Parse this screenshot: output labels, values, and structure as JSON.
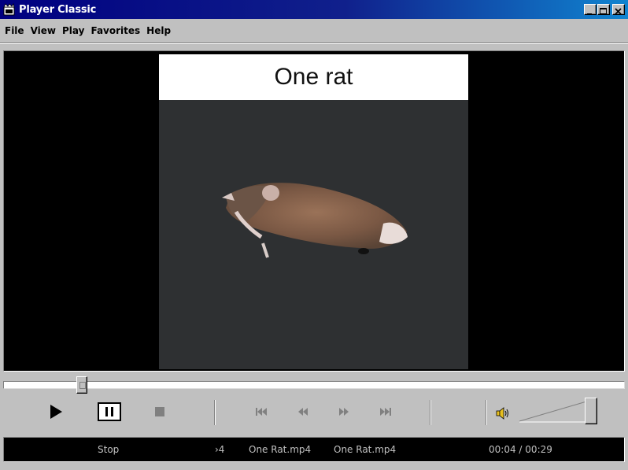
{
  "window": {
    "title": "Player Classic",
    "controls": [
      "minimize",
      "maximize",
      "close"
    ]
  },
  "menu": {
    "items": [
      "File",
      "View",
      "Play",
      "Favorites",
      "Help"
    ]
  },
  "video": {
    "caption": "One rat"
  },
  "seek": {
    "position_fraction": 0.135
  },
  "transport": {
    "play_icon": "play-icon",
    "pause_icon": "pause-icon",
    "stop_icon": "stop-icon",
    "prev_icon": "skip-previous-icon",
    "rewind_icon": "rewind-icon",
    "forward_icon": "fast-forward-icon",
    "next_icon": "skip-next-icon"
  },
  "volume": {
    "icon": "speaker-icon",
    "level_fraction": 1.0
  },
  "status": {
    "state": "Stop",
    "scroll_fragment": "›4",
    "file_name_1": "One Rat.mp4",
    "file_name_2": "One Rat.mp4",
    "time_current": "00:04",
    "time_separator": "/",
    "time_total": "00:29"
  },
  "colors": {
    "titlebar_start": "#000080",
    "titlebar_end": "#1084d0",
    "face": "#c0c0c0",
    "video_bg": "#000000",
    "status_text": "#c0c0c0"
  }
}
